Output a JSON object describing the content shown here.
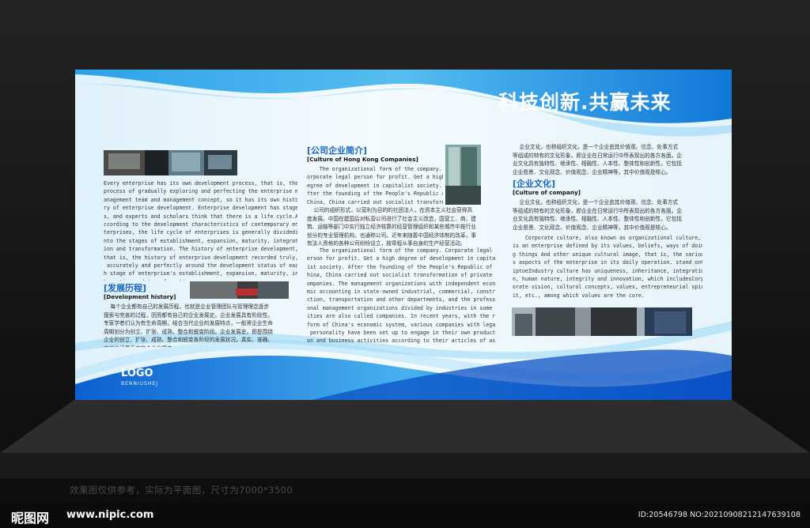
{
  "headline": "科技创新.共赢未来",
  "left": {
    "intro_en": "Every enterprise has its own development process, that is, the\nprocess of gradually exploring and perfecting the enterprise m\nanagement team and management concept, so it has its own histo\nry of enterprise development. Enterprise development has stage\ns, and experts and scholars think that there is a life cycle.A\nccording to the development characteristics of contemporary en\nterprises, the life cycle of enterprises is generally dividedi\nnto the stages of establishment, expansion, maturity, integrat\nion and transformation. The history of enterprise development,\nthat is, the history of enterprise development recorded truly,\n accurately and perfectly around the development status of eac\nh stage of enterprise's establishment, expansion, maturity, in\ntegration and transformation.",
    "heading_cn": "[发展历程]",
    "heading_en": "[Development history]",
    "body_cn": "    每个企业都有自己的发展历程，也就是企业管理团队与管理理念逐步\n摸索与完善的过程，因而都有自己的企业发展史。企业发展具有阶段性，\n专家学者们认为有生命周期，结合当代企业的发展特点，一般将企业生命\n周期划分为创立、扩张、成熟、整合和蜕变阶段。企业发展史，即是围绕\n企业的创立、扩张、成熟、整合和蜕变各阶段的发展状况，真实、准确、\n完善地记录下来的企业发展史。"
  },
  "middle": {
    "heading_cn": "[公司企业简介]",
    "heading_en": "[Culture of Hong Kong Companies]",
    "body_en_1": "    The organizational form of the company. C\norporate legal person for profit. Get a highd\negree of development in capitalist society. A\nfter the founding of the People's Republic of\nChina, China carried out socialist transform",
    "body_cn": "    公司的组织形式，以营利为目的的社团法人，在资本主义社会获得高\n度发展。中国在建国后对私营公司进行了社会主义改造，国营工、商、建\n筑、运输等部门中实行独立经济核算的经营管理组织和某些城市中按行业\n划分的专业管理机构，也通称公司。近年来随着中国经济体制的改革，事\n有法人资格的各种公司纷纷设立，按章程从事自身的生产经营活动。",
    "body_en_2": "    The organizational form of the company. Corporate legal p\nerson for profit. Get a high degree of development in capital\nist society. After the founding of the People's Republic of C\nhina, China carried out socialist transformation of private c\nompanies. The management organizations with independent econo\nmic accounting in state-owned industrial, commercial, constru\nction, transportation and other departments, and the professi\nonal management organizations divided by industries in some c\nities are also called companies. In recent years, with the re\nform of China's economic system, various companies with legal\n personality have been set up to engage in their own producti\non and business activities according to their articles of ass\nociation."
  },
  "right": {
    "top_cn": "    企业文化，也称组织文化，是一个企业由其价值观、信念、处事方式\n等组成的特有的文化形象，即企业在日常运行中所表现出的各方各面。企\n业文化具有独特性、继承性、相融性、人本性、整体性和创新性，它包括\n企业愿景、文化观念、价值观念、企业精神等，其中价值观是核心。",
    "heading_cn": "[企业文化]",
    "heading_en": "[Culture of company]",
    "body_cn": "    企业文化，也称组织文化，是一个企业由其价值观、信念、处事方式\n等组成的特有的文化形象，即企业在日常运行中所表现出的各方各面。企\n业文化具有独特性、继承性、相融性、人本性、整体性和创新性，它包括\n企业愿景、文化观念、价值观念、企业精神等，其中价值观是核心。",
    "body_en": "    Corporate culture, also known as organizational culture,\nis an enterprise defined by its values, beliefs, ways of doin\ng things And other unique cultural image, that is, the variou\ns aspects of the enterprise in its daily operation. stand ont\niptoeIndustry culture has uniqueness, inheritance, integratio\nn, human nature, integrity and innovation, which includesCorp\norate vision, cultural concepts, values, entrepreneurial spir\nit, etc., among which values are the core."
  },
  "logo": {
    "mark": "LOGO",
    "sub": "BENNIUSHEJ"
  },
  "caption": "效果图仅供参考，实际为平面图，尺寸为7000*3500",
  "footer": {
    "brand": "昵图网",
    "url": "www.nipic.com",
    "id": "ID:20546798 NO:20210908212147639108"
  },
  "colors": {
    "accent": "#1a66c4",
    "wave": "#1f8fe0",
    "deep_wave": "#0a54c8"
  }
}
